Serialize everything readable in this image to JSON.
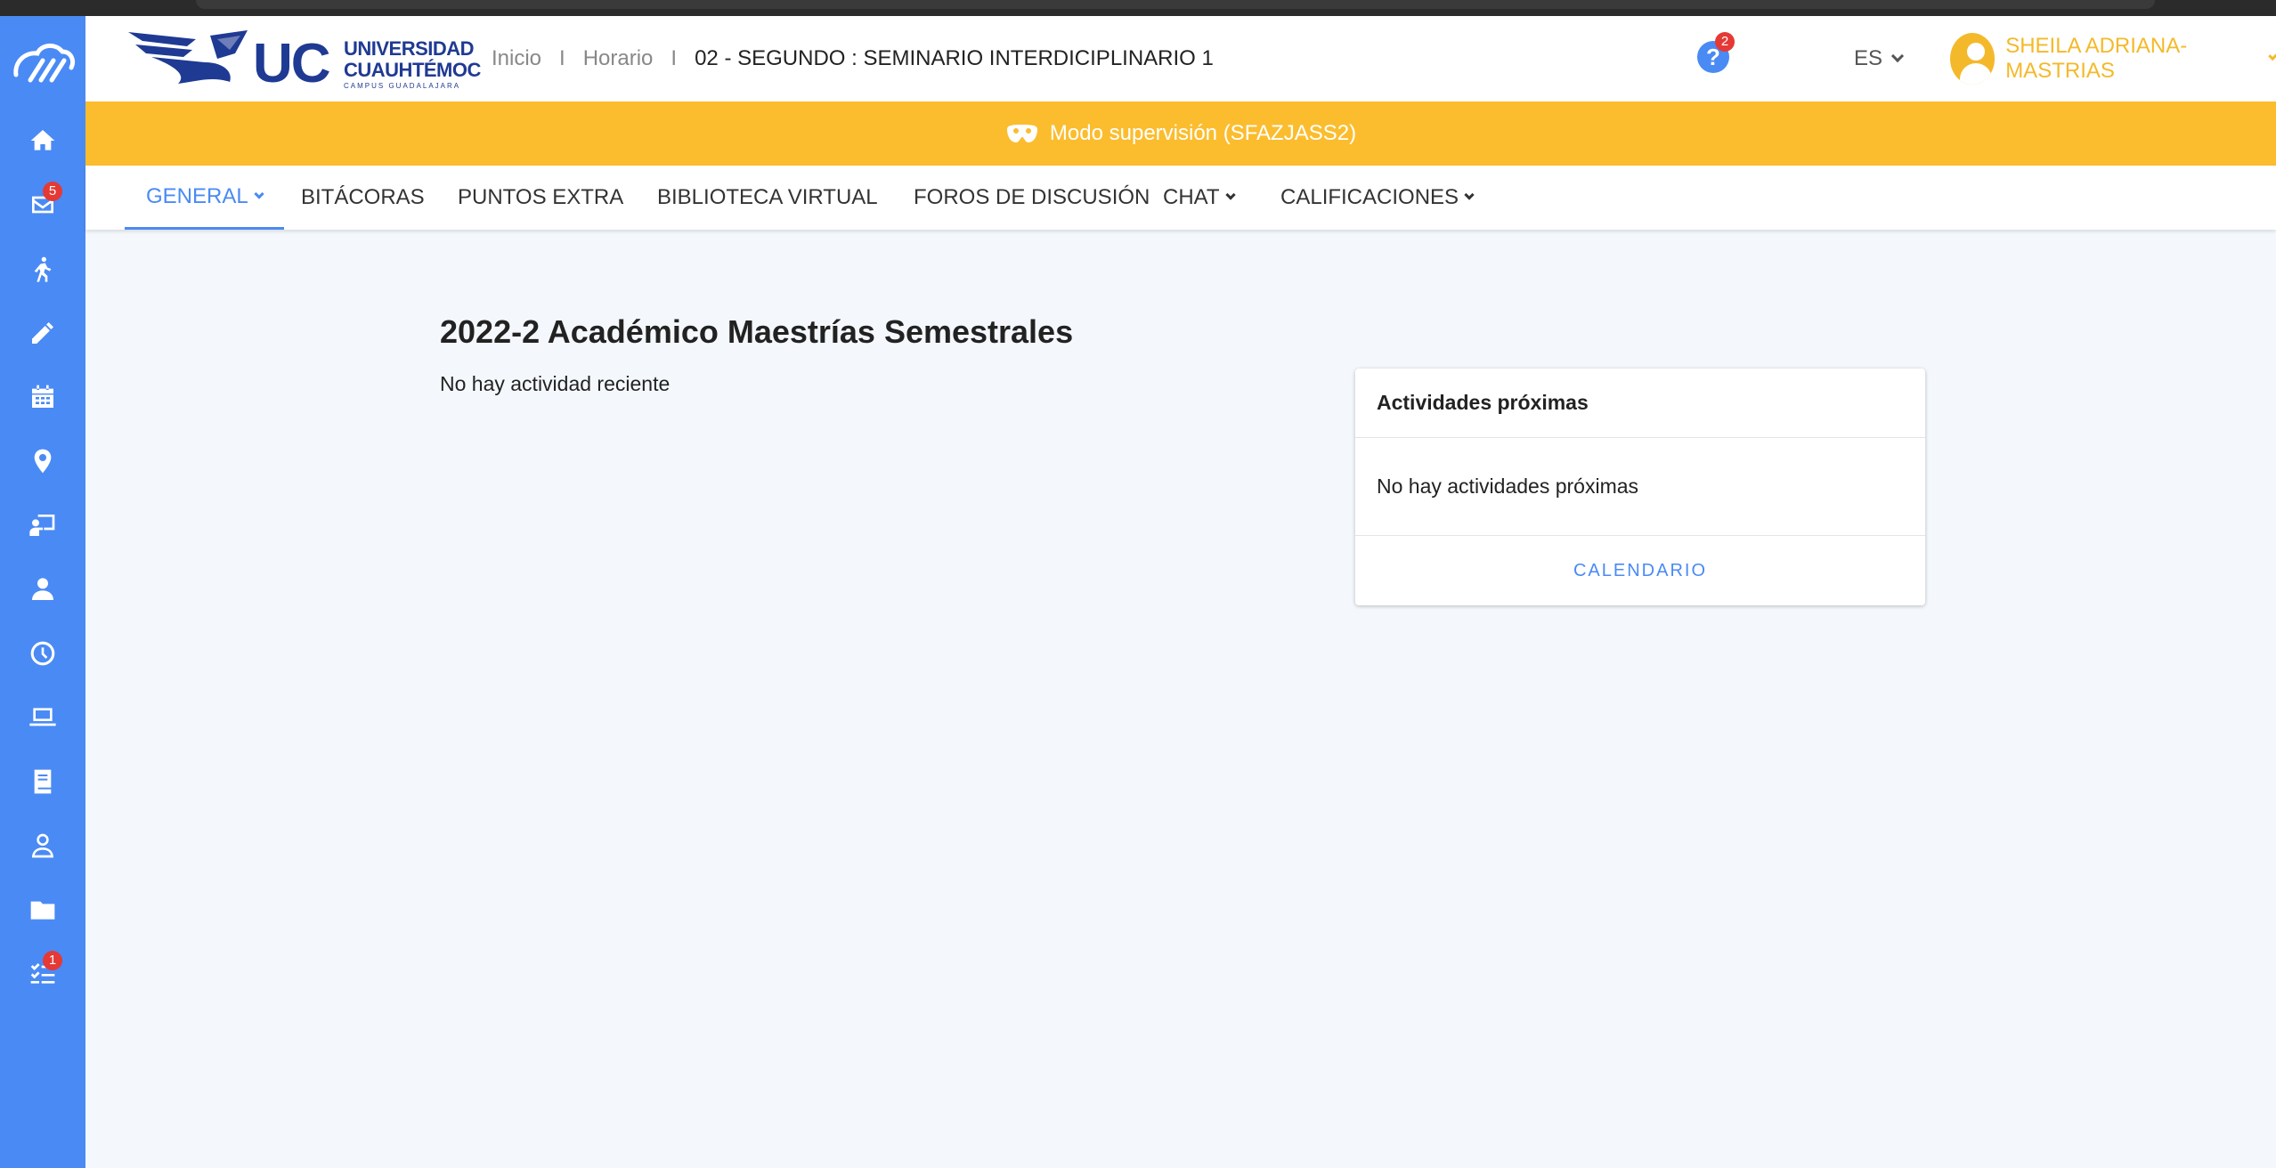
{
  "header": {
    "logo_short": "UC",
    "logo_name_line1": "UNIVERSIDAD",
    "logo_name_line2": "CUAUHTÉMOC",
    "logo_campus": "CAMPUS GUADALAJARA",
    "breadcrumb": {
      "item1": "Inicio",
      "item2": "Horario",
      "separator": "I",
      "current": "02 - SEGUNDO : SEMINARIO INTERDICIPLINARIO 1"
    },
    "help_badge": "2",
    "help_icon": "question-icon",
    "language": "ES",
    "user_name": "SHEILA ADRIANA- MASTRIAS"
  },
  "banner": {
    "icon": "mask-icon",
    "text": "Modo supervisión (SFAZJASS2)"
  },
  "sidebar": {
    "items": [
      {
        "icon": "home-icon"
      },
      {
        "icon": "mail-icon",
        "badge": "5"
      },
      {
        "icon": "walking-icon"
      },
      {
        "icon": "pencil-icon"
      },
      {
        "icon": "calendar-icon"
      },
      {
        "icon": "location-pin-icon"
      },
      {
        "icon": "teacher-board-icon"
      },
      {
        "icon": "user-icon"
      },
      {
        "icon": "clock-icon"
      },
      {
        "icon": "laptop-icon"
      },
      {
        "icon": "book-icon"
      },
      {
        "icon": "user-outline-icon"
      },
      {
        "icon": "folder-icon"
      },
      {
        "icon": "checklist-icon",
        "badge": "1"
      }
    ]
  },
  "tabs": [
    {
      "label": "GENERAL",
      "active": true,
      "dropdown": true
    },
    {
      "label": "BITÁCORAS"
    },
    {
      "label": "PUNTOS EXTRA"
    },
    {
      "label": "BIBLIOTECA VIRTUAL"
    },
    {
      "label": "FOROS DE DISCUSIÓN"
    },
    {
      "label": "CHAT",
      "dropdown": true
    },
    {
      "label": "CALIFICACIONES",
      "dropdown": true
    }
  ],
  "main": {
    "title": "2022-2 Académico Maestrías Semestrales",
    "recent_activity": "No hay actividad reciente"
  },
  "upcoming_card": {
    "title": "Actividades próximas",
    "empty_text": "No hay actividades próximas",
    "calendar_link": "CALENDARIO"
  },
  "colors": {
    "sidebar": "#4a8af4",
    "banner": "#fbbd2e",
    "brand_navy": "#1f3a93",
    "accent": "#4a8af4",
    "badge": "#e53935",
    "user": "#f4b92a"
  }
}
